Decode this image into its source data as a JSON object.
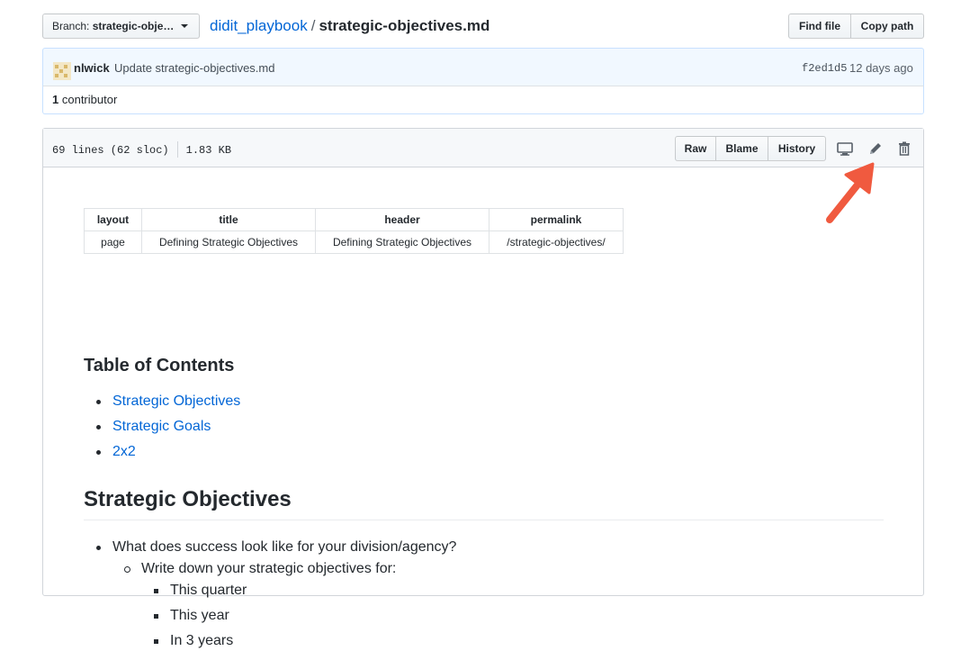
{
  "header": {
    "branch_prefix": "Branch:",
    "branch_name": "strategic-obje…",
    "repo": "didit_playbook",
    "separator": "/",
    "filename": "strategic-objectives.md",
    "find_file": "Find file",
    "copy_path": "Copy path"
  },
  "commit": {
    "author": "nlwick",
    "message": "Update strategic-objectives.md",
    "sha": "f2ed1d5",
    "time": "12 days ago"
  },
  "contributors": {
    "count": "1",
    "label": "contributor"
  },
  "file": {
    "lines": "69 lines (62 sloc)",
    "size": "1.83 KB",
    "raw": "Raw",
    "blame": "Blame",
    "history": "History",
    "icons": [
      "desktop-icon",
      "pencil-icon",
      "trash-icon"
    ]
  },
  "frontmatter": {
    "headers": [
      "layout",
      "title",
      "header",
      "permalink"
    ],
    "row": [
      "page",
      "Defining Strategic Objectives",
      "Defining Strategic Objectives",
      "/strategic-objectives/"
    ]
  },
  "content": {
    "toc_heading": "Table of Contents",
    "toc_links": [
      "Strategic Objectives",
      "Strategic Goals",
      "2x2"
    ],
    "section_heading": "Strategic Objectives",
    "question": "What does success look like for your division/agency?",
    "instruction": "Write down your strategic objectives for:",
    "timeframes": [
      "This quarter",
      "This year",
      "In 3 years"
    ]
  },
  "colors": {
    "link": "#0366d6",
    "annotation_arrow": "#f05a3f"
  }
}
